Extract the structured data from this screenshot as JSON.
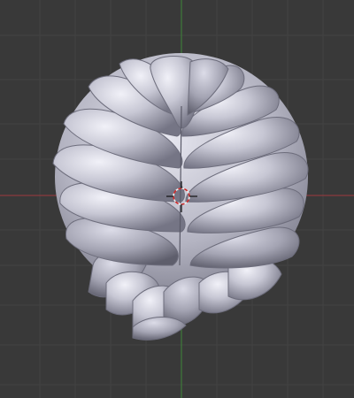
{
  "viewport": {
    "mode": "3d-viewport",
    "background_color": "#393939",
    "grid_color": "#444444",
    "x_axis_color": "#8c3a3f",
    "y_axis_color": "#3f7a3a",
    "cursor_color_a": "#d22b2b",
    "cursor_color_b": "#f0f0f0",
    "model_base_color": "#a9a9b8",
    "model_highlight_color": "#eeeef6",
    "model_shadow_color": "#6e6e7e",
    "icons": [
      "3d-cursor-icon"
    ]
  }
}
